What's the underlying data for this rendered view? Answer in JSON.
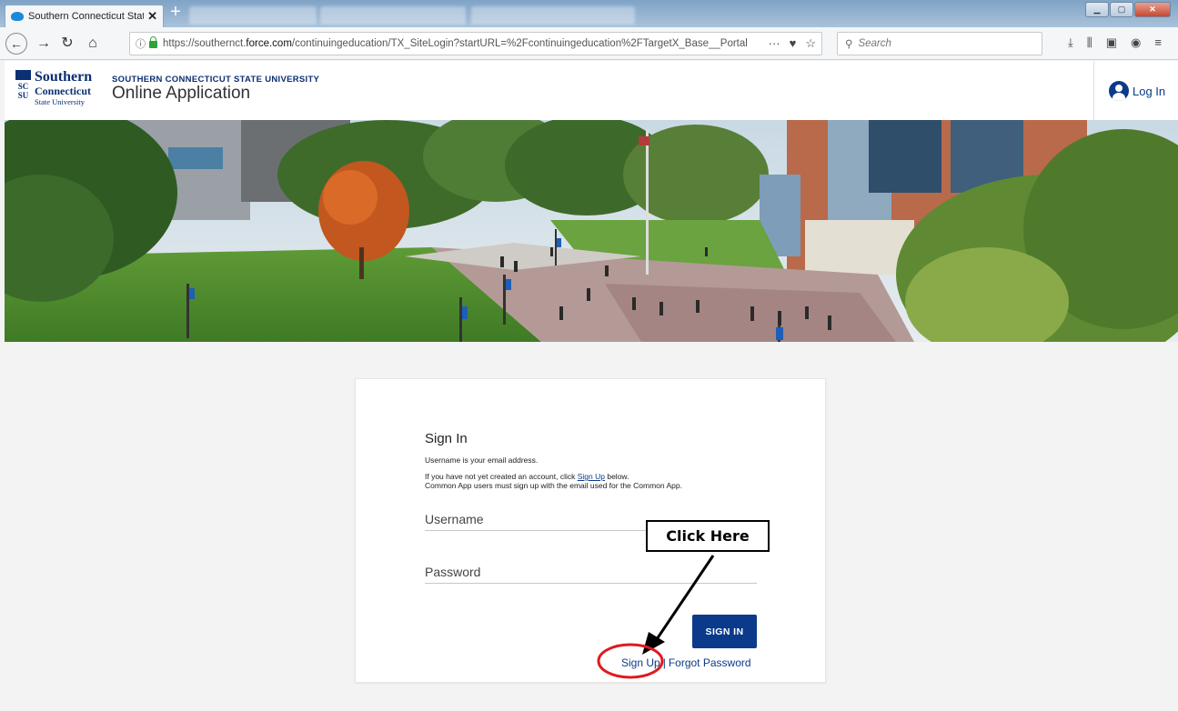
{
  "browser": {
    "tab_title": "Southern Connecticut State Un",
    "tab_close": "✕",
    "new_tab": "+",
    "url_prefix": "https://southernct.",
    "url_host": "force.com",
    "url_path": "/continuingeducation/TX_SiteLogin?startURL=%2Fcontinuingeducation%2FTargetX_Base__Portal",
    "search_placeholder": "Search",
    "icons": [
      "back-icon",
      "forward-icon",
      "reload-icon",
      "home-icon",
      "info-icon",
      "lock-icon",
      "page-actions-icon",
      "pocket-icon",
      "bookmark-star-icon",
      "search-icon",
      "download-icon",
      "library-icon",
      "sidebar-icon",
      "account-icon",
      "menu-icon"
    ]
  },
  "header": {
    "logo_line1": "Southern",
    "logo_line2": "Connecticut",
    "logo_line3": "State University",
    "logo_mark": "SC SU",
    "university_name": "SOUTHERN CONNECTICUT STATE UNIVERSITY",
    "app_title": "Online Application",
    "login_label": "Log In"
  },
  "signin": {
    "title": "Sign In",
    "note_username": "Username is your email address.",
    "note_account_prefix": "If you have not yet created an account, click ",
    "note_account_link": "Sign Up",
    "note_account_suffix": " below.",
    "note_commonapp": "Common App users must sign up with the email used for the Common App.",
    "username_placeholder": "Username",
    "password_placeholder": "Password",
    "button_label": "SIGN IN",
    "signup_link": "Sign Up",
    "separator": "|",
    "forgot_link": "Forgot Password"
  },
  "annotation": {
    "callout_text": "Click Here",
    "highlight_color": "#e0191f"
  },
  "colors": {
    "brand_navy": "#0b3a8a",
    "page_background": "#f3f3f3"
  }
}
